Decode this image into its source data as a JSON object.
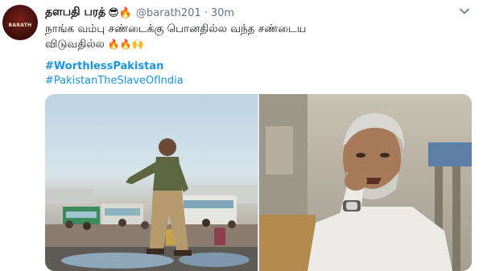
{
  "tweet": {
    "display_name": "தளபதி பரத்",
    "name_emojis": "😎🔥",
    "handle": "@barath201",
    "separator": "·",
    "timestamp": "30m",
    "text_line1": "நாங்க வம்பு சண்டைக்கு பொனதில்ல வந்த சண்டைய",
    "text_line2": "விடுவதில்ல",
    "text_emojis": "🔥🔥🙌",
    "hashtags": [
      "#WorthlessPakistan",
      "#PakistanTheSlaveOfIndia"
    ],
    "avatar_text": "BARATH"
  },
  "icons": {
    "more": "chevron-down-icon"
  },
  "colors": {
    "link": "#1b95e0",
    "text": "#14171a",
    "secondary": "#657786"
  }
}
